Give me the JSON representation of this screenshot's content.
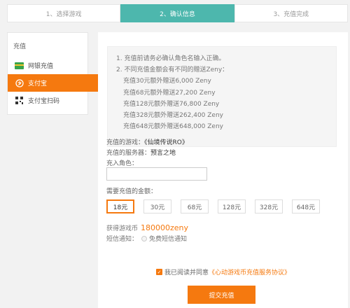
{
  "steps": [
    {
      "label": "1、选择游戏",
      "active": false
    },
    {
      "label": "2、确认信息",
      "active": true
    },
    {
      "label": "3、充值完成",
      "active": false
    }
  ],
  "sidebar": {
    "title": "充值",
    "items": [
      {
        "label": "网银充值",
        "icon": "bank-card-icon"
      },
      {
        "label": "支付宝",
        "icon": "alipay-icon",
        "active": true
      },
      {
        "label": "支付宝扫码",
        "icon": "qr-code-icon"
      }
    ]
  },
  "notice": {
    "lines": [
      "1. 充值前请务必确认角色名输入正确。",
      "2. 不同充值金额会有不同的赠送Zeny：",
      "充值30元额外赠送6,000 Zeny",
      "充值68元额外赠送27,200 Zeny",
      "充值128元额外赠送76,800 Zeny",
      "充值328元额外赠送262,400 Zeny",
      "充值648元额外赠送648,000 Zeny"
    ]
  },
  "form": {
    "game_label": "充值的游戏：",
    "game_value": "《仙境传说RO》",
    "server_label": "充值的服务器：",
    "server_value": "预言之地",
    "role_label": "充入角色：",
    "role_value": "",
    "amount_label": "需要充值的金额：",
    "amounts": [
      "18元",
      "30元",
      "68元",
      "128元",
      "328元",
      "648元"
    ],
    "selected_amount": "18元",
    "gain_label": "获得游戏币",
    "gain_value": "180000zeny",
    "sms_label": "短信通知：",
    "sms_option": "免费短信通知",
    "agree_text": "我已阅读并同意",
    "agree_link": "《心动游戏币充值服务协议》",
    "submit_label": "提交充值"
  },
  "colors": {
    "accent": "#f5790f",
    "step_active": "#4db7ad"
  }
}
